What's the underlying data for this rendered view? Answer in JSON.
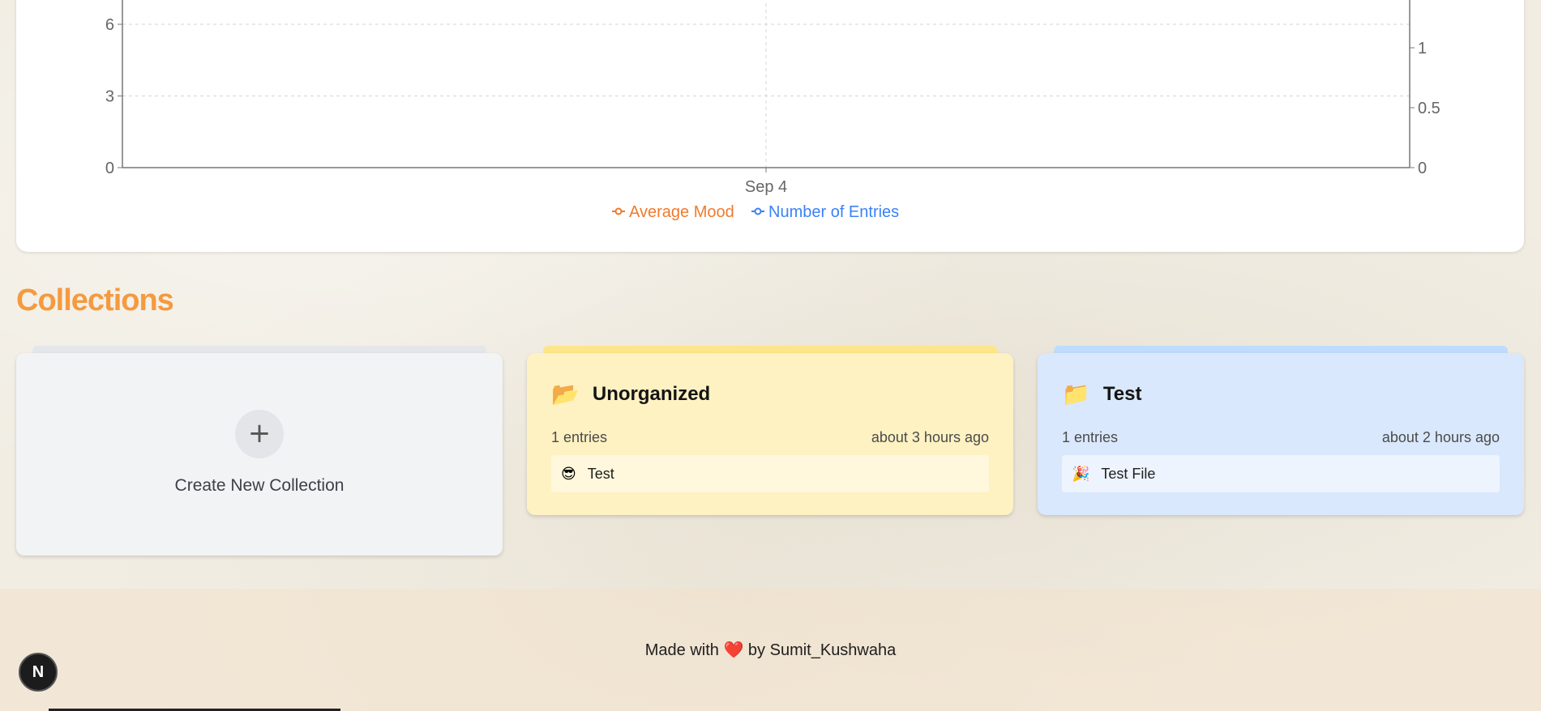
{
  "chart_data": {
    "type": "line",
    "x": [
      "Sep 4"
    ],
    "left_axis": {
      "ticks": [
        "0",
        "3",
        "6"
      ]
    },
    "right_axis": {
      "ticks": [
        "0",
        "0.5",
        "1"
      ]
    },
    "legend": [
      "Average Mood",
      "Number of Entries"
    ],
    "series": [
      {
        "name": "Average Mood",
        "color": "#f07a2c",
        "axis": "left"
      },
      {
        "name": "Number of Entries",
        "color": "#3b82f6",
        "axis": "right"
      }
    ],
    "grid": true,
    "legend_position": "bottom"
  },
  "collections_title": "Collections",
  "new_collection": {
    "label": "Create New Collection",
    "icon": "plus-icon",
    "plus": "+"
  },
  "collections": [
    {
      "name": "Unorganized",
      "icon": "folder-icon",
      "folder": "📂",
      "entries": "1 entries",
      "updated": "about 3 hours ago",
      "items": [
        {
          "label": "Test",
          "icon": "smiley-icon",
          "emoji": "😎"
        }
      ],
      "color": "#fef1c2"
    },
    {
      "name": "Test",
      "icon": "folder-icon",
      "folder": "📁",
      "entries": "1 entries",
      "updated": "about 2 hours ago",
      "items": [
        {
          "label": "Test File",
          "icon": "party-popper-icon",
          "emoji": "🎉"
        }
      ],
      "color": "#d9e8fc"
    }
  ],
  "footer": {
    "made_with": "Made with",
    "heart": "❤️",
    "by": "by Sumit_Kushwaha"
  },
  "badge": {
    "letter": "N"
  }
}
